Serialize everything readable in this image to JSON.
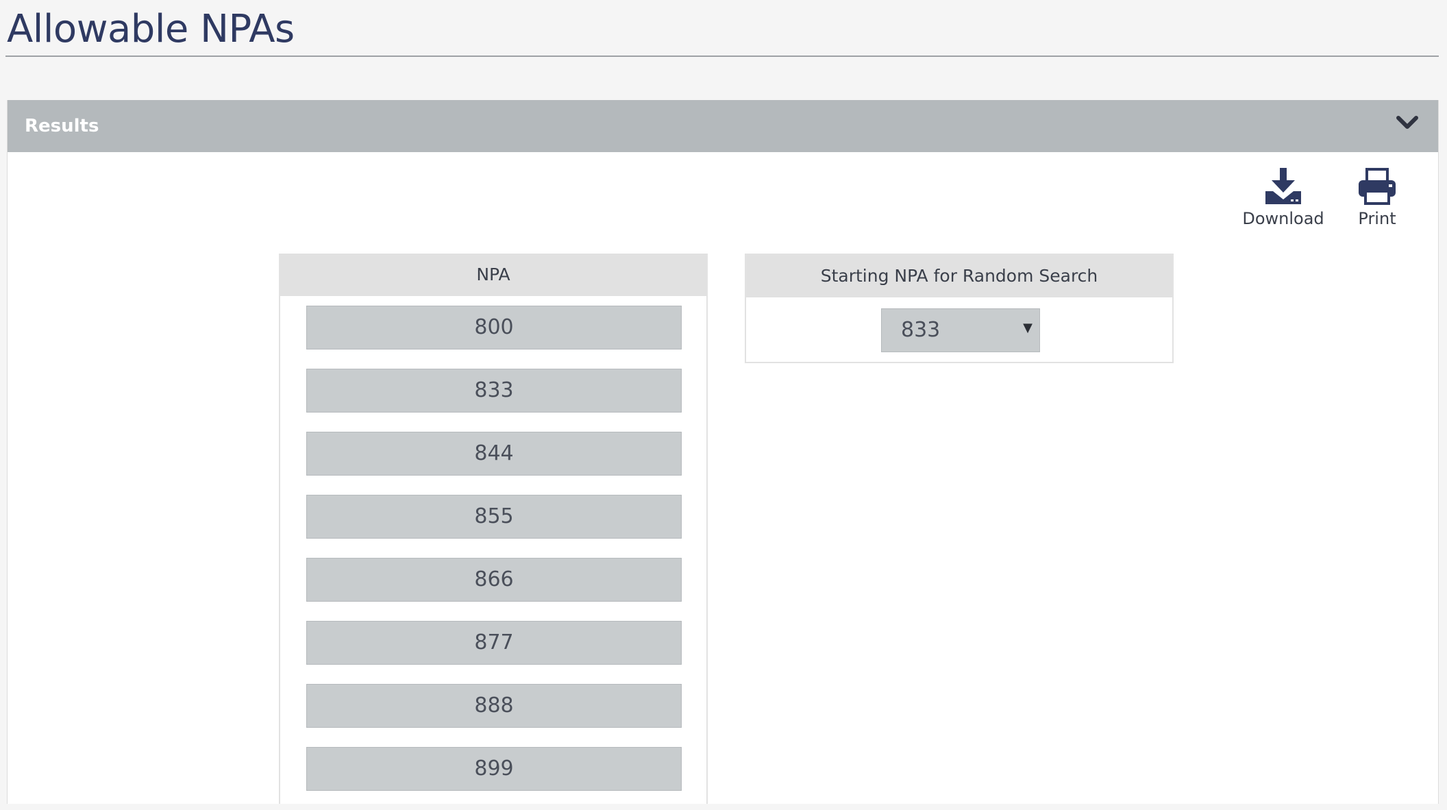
{
  "page": {
    "title": "Allowable NPAs"
  },
  "results": {
    "header": "Results",
    "toolbar": {
      "download_label": "Download",
      "print_label": "Print"
    },
    "npa_table": {
      "column_header": "NPA",
      "items": [
        "800",
        "833",
        "844",
        "855",
        "866",
        "877",
        "888",
        "899"
      ]
    },
    "random_search": {
      "column_header": "Starting NPA for Random Search",
      "selected_value": "833"
    }
  },
  "colors": {
    "title_text": "#2f3a62",
    "panel_header_bg": "#b4b9bc",
    "icon_color": "#2f3a62",
    "cell_bg": "#c8ccce"
  },
  "icons": {
    "collapse": "chevron-down-icon",
    "download": "download-icon",
    "print": "printer-icon"
  }
}
